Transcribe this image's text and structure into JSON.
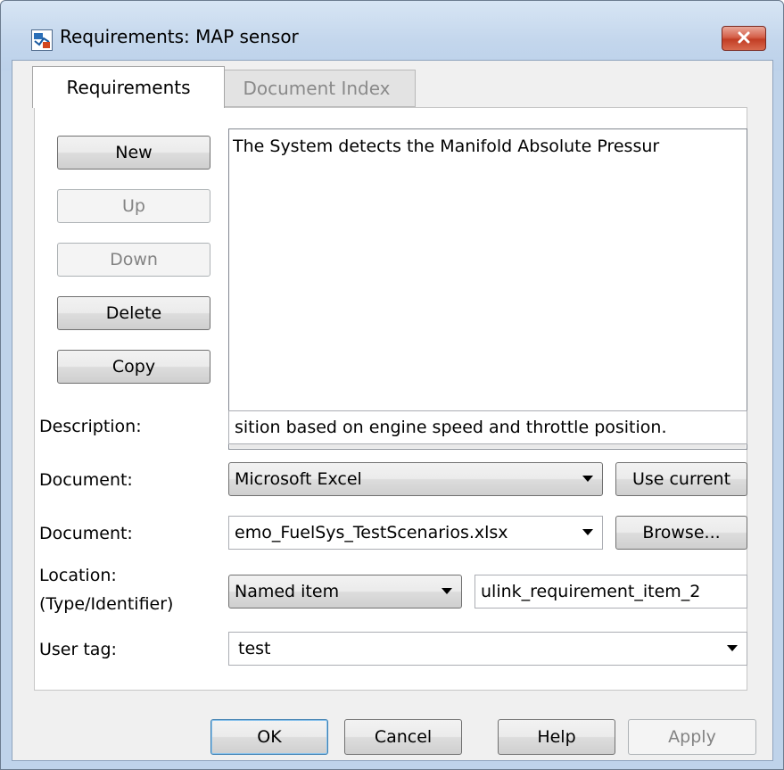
{
  "window": {
    "title": "Requirements: MAP sensor",
    "close_icon": "close-x-icon"
  },
  "tabs": [
    {
      "label": "Requirements",
      "active": true
    },
    {
      "label": "Document Index",
      "active": false
    }
  ],
  "side_buttons": {
    "new": "New",
    "up": "Up",
    "down": "Down",
    "delete": "Delete",
    "copy": "Copy"
  },
  "requirements_list": {
    "items": [
      "The System detects the Manifold Absolute Pressur"
    ]
  },
  "form": {
    "description_label": "Description:",
    "description_value": "sition based on engine speed and throttle position.",
    "document_type_label": "Document:",
    "document_type_value": "Microsoft Excel",
    "use_current_label": "Use current",
    "document_label": "Document:",
    "document_value": "emo_FuelSys_TestScenarios.xlsx",
    "browse_label": "Browse...",
    "location_label_line1": "Location:",
    "location_label_line2": "(Type/Identifier)",
    "location_type_value": "Named item",
    "location_id_value": "ulink_requirement_item_2",
    "user_tag_label": "User tag:",
    "user_tag_value": "test"
  },
  "footer": {
    "ok": "OK",
    "cancel": "Cancel",
    "help": "Help",
    "apply": "Apply"
  },
  "colors": {
    "window_frame": "#bfd3ea",
    "close_button": "#c23d24",
    "default_button_border": "#3c7fb1"
  }
}
